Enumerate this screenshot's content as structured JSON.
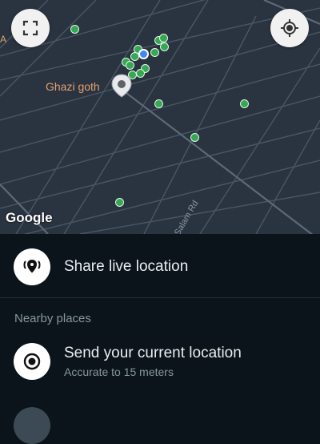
{
  "map": {
    "place_label": "Ghazi goth",
    "road_label": "Salam Rd",
    "attribution": "Google",
    "left_edge_label": "A",
    "colors": {
      "background": "#2a3340",
      "roads": "#4a5665",
      "poi": "#34a853",
      "user_dot": "#4285f4",
      "place_label": "#e3a06d"
    },
    "buttons": {
      "fullscreen_icon": "fullscreen-icon",
      "recenter_icon": "my-location-icon"
    }
  },
  "sheet": {
    "share_live": {
      "label": "Share live location",
      "icon": "live-location-icon"
    },
    "nearby_header": "Nearby places",
    "current_location": {
      "label": "Send your current location",
      "subtitle": "Accurate to 15 meters",
      "icon": "current-location-icon"
    }
  },
  "colors": {
    "sheet_background": "#0b141a",
    "primary_text": "#e9edef",
    "secondary_text": "#8696a0"
  }
}
